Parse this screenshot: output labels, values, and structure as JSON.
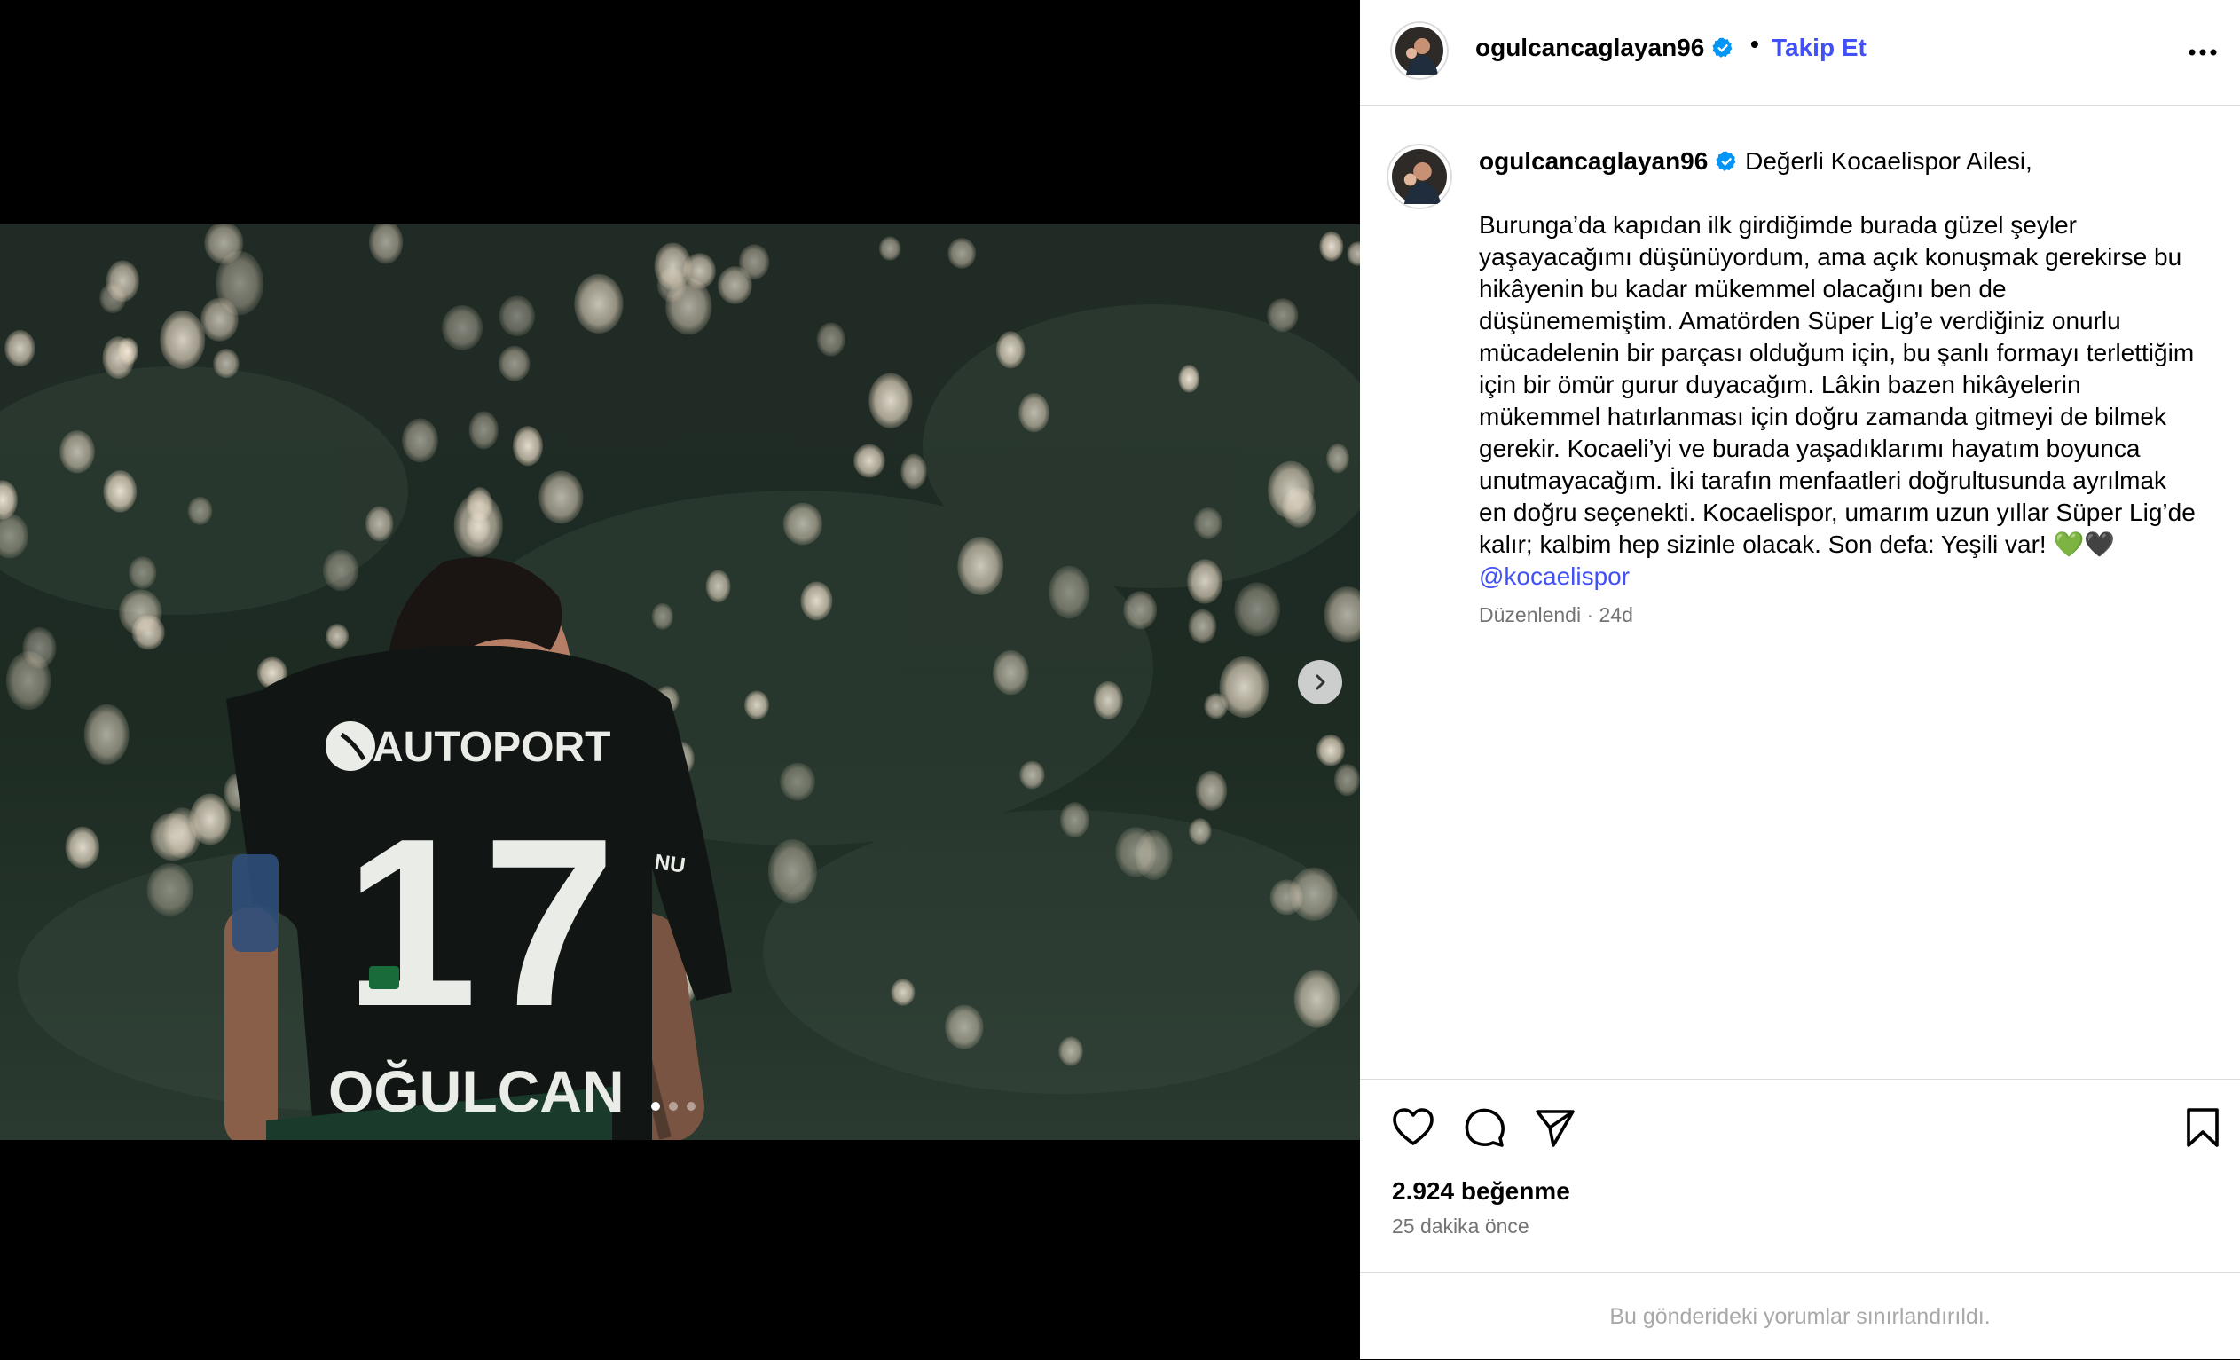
{
  "post": {
    "username": "ogulcancaglayan96",
    "separator": "•",
    "follow_label": "Takip Et",
    "caption_opening": "Değerli Kocaelispor Ailesi,",
    "caption_body": "Burunga’da kapıdan ilk girdiğimde burada güzel şeyler\nyaşayacağımı düşünüyordum, ama açık konuşmak gerekirse bu\nhikâyenin bu kadar mükemmel olacağını ben de\ndüşünememiştim. Amatörden Süper Lig’e verdiğiniz onurlu\nmücadelenin bir parçası olduğum için, bu şanlı formayı terlettiğim\niçin bir ömür gurur duyacağım. Lâkin bazen hikâyelerin\nmükemmel hatırlanması için doğru zamanda gitmeyi de bilmek\ngerekir. Kocaeli’yi ve burada yaşadıklarımı hayatım boyunca\nunutmayacağım. İki tarafın menfaatleri doğrultusunda ayrılmak\nen doğru seçenekti. Kocaelispor, umarım uzun yıllar Süper Lig’de\nkalır; kalbim hep sizinle olacak. Son defa: Yeşili var! 💚🖤",
    "mention": "@kocaelispor",
    "meta": "Düzenlendi · 24d",
    "likes": "2.924 beğenme",
    "time_ago": "25 dakika önce",
    "comments_limited": "Bu gönderideki yorumlar sınırlandırıldı."
  },
  "jersey": {
    "sponsor": "AUTOPORT",
    "number": "17",
    "name": "OĞULCAN",
    "side_logo": "NU"
  },
  "carousel": {
    "count": 3,
    "active": 0
  },
  "icons": {
    "verified": "verified-badge-icon",
    "more": "more-options-icon",
    "next": "chevron-right-icon",
    "like": "heart-icon",
    "comment": "comment-icon",
    "share": "share-icon",
    "save": "bookmark-icon"
  },
  "colors": {
    "link": "#4150f7",
    "verified": "#0095f6",
    "muted": "#737373",
    "divider": "#dbdbdb"
  }
}
